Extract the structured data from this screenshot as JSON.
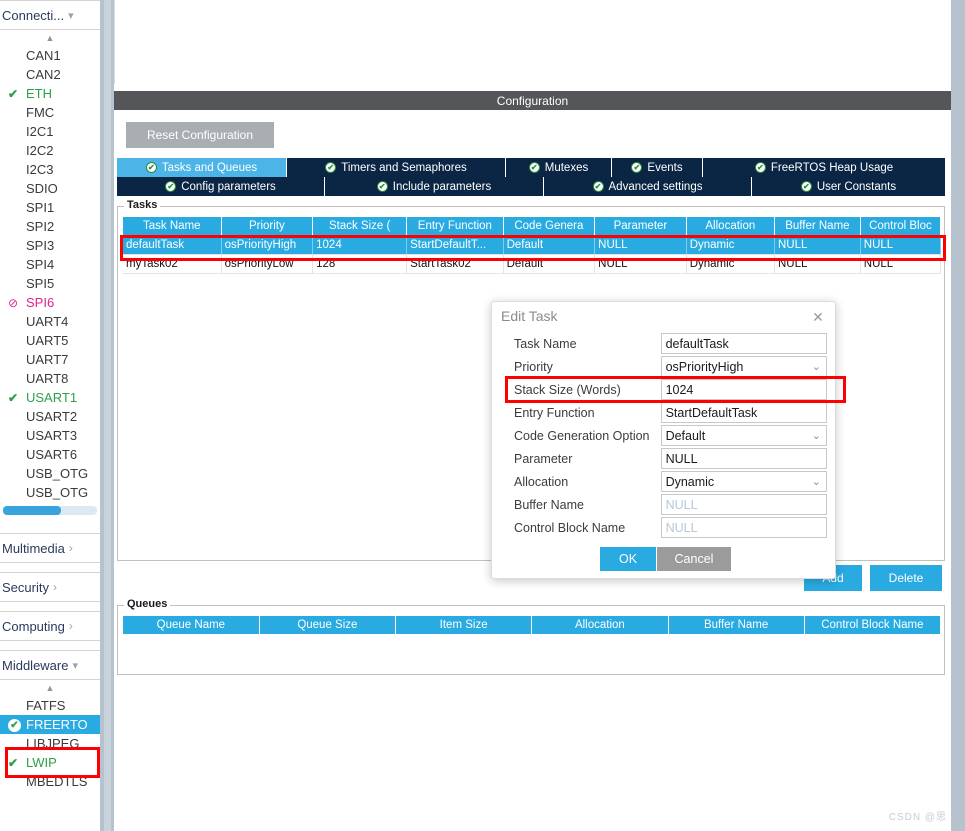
{
  "sidebar": {
    "groups": [
      {
        "label": "Connecti...",
        "caret": "chevron-down-icon",
        "expanded": true
      },
      {
        "label": "Multimedia",
        "caret": "chevron-right-icon",
        "expanded": false
      },
      {
        "label": "Security",
        "caret": "chevron-right-icon",
        "expanded": false
      },
      {
        "label": "Computing",
        "caret": "chevron-right-icon",
        "expanded": false
      },
      {
        "label": "Middleware",
        "caret": "chevron-down-icon",
        "expanded": true
      }
    ],
    "connectivity_items": [
      {
        "label": "CAN1",
        "state": "none"
      },
      {
        "label": "CAN2",
        "state": "none"
      },
      {
        "label": "ETH",
        "state": "ok"
      },
      {
        "label": "FMC",
        "state": "none"
      },
      {
        "label": "I2C1",
        "state": "none"
      },
      {
        "label": "I2C2",
        "state": "none"
      },
      {
        "label": "I2C3",
        "state": "none"
      },
      {
        "label": "SDIO",
        "state": "none"
      },
      {
        "label": "SPI1",
        "state": "none"
      },
      {
        "label": "SPI2",
        "state": "none"
      },
      {
        "label": "SPI3",
        "state": "none"
      },
      {
        "label": "SPI4",
        "state": "none"
      },
      {
        "label": "SPI5",
        "state": "none"
      },
      {
        "label": "SPI6",
        "state": "error"
      },
      {
        "label": "UART4",
        "state": "none"
      },
      {
        "label": "UART5",
        "state": "none"
      },
      {
        "label": "UART7",
        "state": "none"
      },
      {
        "label": "UART8",
        "state": "none"
      },
      {
        "label": "USART1",
        "state": "ok"
      },
      {
        "label": "USART2",
        "state": "none"
      },
      {
        "label": "USART3",
        "state": "none"
      },
      {
        "label": "USART6",
        "state": "none"
      },
      {
        "label": "USB_OTG",
        "state": "none"
      },
      {
        "label": "USB_OTG",
        "state": "none"
      }
    ],
    "middleware_items": [
      {
        "label": "FATFS",
        "state": "none",
        "selected": false
      },
      {
        "label": "FREERTO",
        "state": "ok",
        "selected": true
      },
      {
        "label": "LIBJPEG",
        "state": "none",
        "selected": false
      },
      {
        "label": "LWIP",
        "state": "ok",
        "selected": false
      },
      {
        "label": "MBEDTLS",
        "state": "none",
        "selected": false
      }
    ]
  },
  "main": {
    "header_title": "Configuration",
    "reset_button": "Reset Configuration",
    "tabs_row1": [
      {
        "label": "Tasks and Queues",
        "active": true
      },
      {
        "label": "Timers and Semaphores",
        "active": false
      },
      {
        "label": "Mutexes",
        "active": false
      },
      {
        "label": "Events",
        "active": false
      },
      {
        "label": "FreeRTOS Heap Usage",
        "active": false
      }
    ],
    "tabs_row2": [
      {
        "label": "Config parameters",
        "active": false
      },
      {
        "label": "Include parameters",
        "active": false
      },
      {
        "label": "Advanced settings",
        "active": false
      },
      {
        "label": "User Constants",
        "active": false
      }
    ],
    "tasks": {
      "legend": "Tasks",
      "columns": [
        "Task Name",
        "Priority",
        "Stack Size (",
        "Entry Function",
        "Code Genera",
        "Parameter",
        "Allocation",
        "Buffer Name",
        "Control Bloc"
      ],
      "rows": [
        {
          "selected": true,
          "cells": [
            "defaultTask",
            "osPriorityHigh",
            "1024",
            "StartDefaultT...",
            "Default",
            "NULL",
            "Dynamic",
            "NULL",
            "NULL"
          ]
        },
        {
          "selected": false,
          "cells": [
            "myTask02",
            "osPriorityLow",
            "128",
            "StartTask02",
            "Default",
            "NULL",
            "Dynamic",
            "NULL",
            "NULL"
          ]
        }
      ],
      "add_button": "Add",
      "delete_button": "Delete"
    },
    "queues": {
      "legend": "Queues",
      "columns": [
        "Queue Name",
        "Queue Size",
        "Item Size",
        "Allocation",
        "Buffer Name",
        "Control Block Name"
      ],
      "rows": []
    }
  },
  "dialog": {
    "title": "Edit Task",
    "close_icon": "close-icon",
    "fields": [
      {
        "label": "Task Name",
        "value": "defaultTask",
        "type": "text",
        "placeholder": false
      },
      {
        "label": "Priority",
        "value": "osPriorityHigh",
        "type": "select",
        "placeholder": false
      },
      {
        "label": "Stack Size (Words)",
        "value": "1024",
        "type": "text",
        "placeholder": false
      },
      {
        "label": "Entry Function",
        "value": "StartDefaultTask",
        "type": "text",
        "placeholder": false
      },
      {
        "label": "Code Generation Option",
        "value": "Default",
        "type": "select",
        "placeholder": false
      },
      {
        "label": "Parameter",
        "value": "NULL",
        "type": "text",
        "placeholder": false
      },
      {
        "label": "Allocation",
        "value": "Dynamic",
        "type": "select",
        "placeholder": false
      },
      {
        "label": "Buffer Name",
        "value": "NULL",
        "type": "text",
        "placeholder": true
      },
      {
        "label": "Control Block Name",
        "value": "NULL",
        "type": "text",
        "placeholder": true
      }
    ],
    "ok_button": "OK",
    "cancel_button": "Cancel"
  },
  "watermark": "CSDN @思",
  "colors": {
    "accent_blue": "#29ABE2",
    "tab_navy": "#0b2545",
    "header_gray": "#545659",
    "ok_green": "#2fa04a",
    "error_pink": "#e0218a",
    "annotation_red": "#ff0000"
  }
}
